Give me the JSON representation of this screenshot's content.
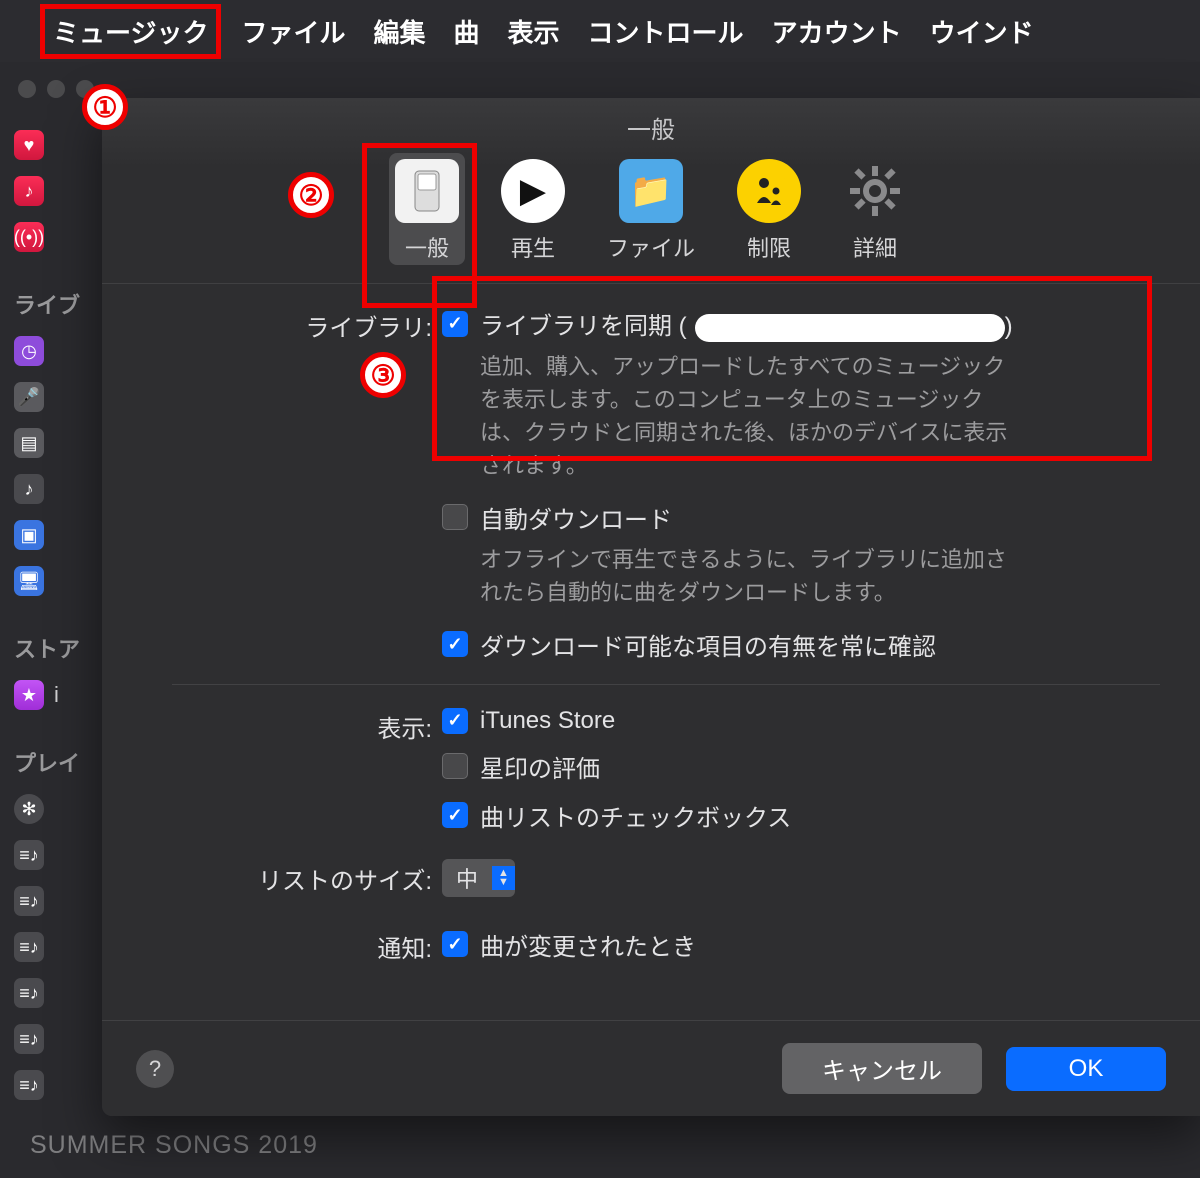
{
  "menubar": {
    "items": [
      "ミュージック",
      "ファイル",
      "編集",
      "曲",
      "表示",
      "コントロール",
      "アカウント",
      "ウインド"
    ]
  },
  "annotations": {
    "n1": "①",
    "n2": "②",
    "n3": "③"
  },
  "sidebar": {
    "sec_library": "ライブ",
    "sec_store": "ストア",
    "sec_playlists": "プレイ",
    "bottom_playlist": "SUMMER SONGS 2019"
  },
  "panel": {
    "title": "一般",
    "tabs": {
      "general": "一般",
      "playback": "再生",
      "files": "ファイル",
      "restrictions": "制限",
      "advanced": "詳細"
    }
  },
  "prefs": {
    "library_label": "ライブラリ:",
    "sync_library": "ライブラリを同期",
    "sync_desc": "追加、購入、アップロードしたすべてのミュージックを表示します。このコンピュータ上のミュージックは、クラウドと同期された後、ほかのデバイスに表示されます。",
    "auto_dl": "自動ダウンロード",
    "auto_dl_desc": "オフラインで再生できるように、ライブラリに追加されたら自動的に曲をダウンロードします。",
    "always_check": "ダウンロード可能な項目の有無を常に確認",
    "show_label": "表示:",
    "itunes_store": "iTunes Store",
    "star_rating": "星印の評価",
    "list_checkboxes": "曲リストのチェックボックス",
    "list_size_label": "リストのサイズ:",
    "list_size_value": "中",
    "notify_label": "通知:",
    "notify_song_change": "曲が変更されたとき"
  },
  "footer": {
    "cancel": "キャンセル",
    "ok": "OK",
    "help": "?"
  }
}
